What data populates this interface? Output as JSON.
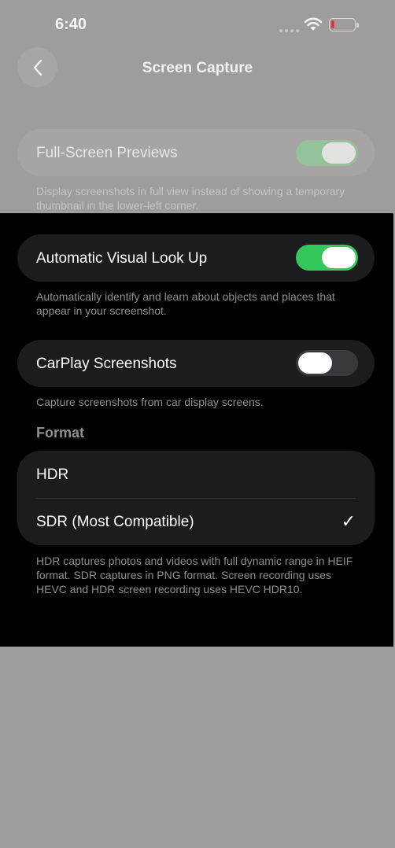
{
  "status": {
    "time": "6:40"
  },
  "nav": {
    "title": "Screen Capture"
  },
  "full_screen_previews": {
    "label": "Full-Screen Previews",
    "enabled": true,
    "footer": "Display screenshots in full view instead of showing a temporary thumbnail in the lower-left corner."
  },
  "visual_look_up": {
    "label": "Automatic Visual Look Up",
    "enabled": true,
    "footer": "Automatically identify and learn about objects and places that appear in your screenshot."
  },
  "carplay": {
    "label": "CarPlay Screenshots",
    "enabled": false,
    "footer": "Capture screenshots from car display screens."
  },
  "format": {
    "header": "Format",
    "options": [
      {
        "label": "HDR",
        "selected": false
      },
      {
        "label": "SDR (Most Compatible)",
        "selected": true
      }
    ],
    "checkmark": "✓",
    "footer": "HDR captures photos and videos with full dynamic range in HEIF format. SDR captures in PNG format. Screen recording uses HEVC and HDR screen recording uses HEVC HDR10."
  },
  "colors": {
    "toggle_on": "#34c759",
    "toggle_off": "#39393d",
    "card_bg": "#1c1c1e",
    "dim_overlay": "#a09c9b"
  }
}
